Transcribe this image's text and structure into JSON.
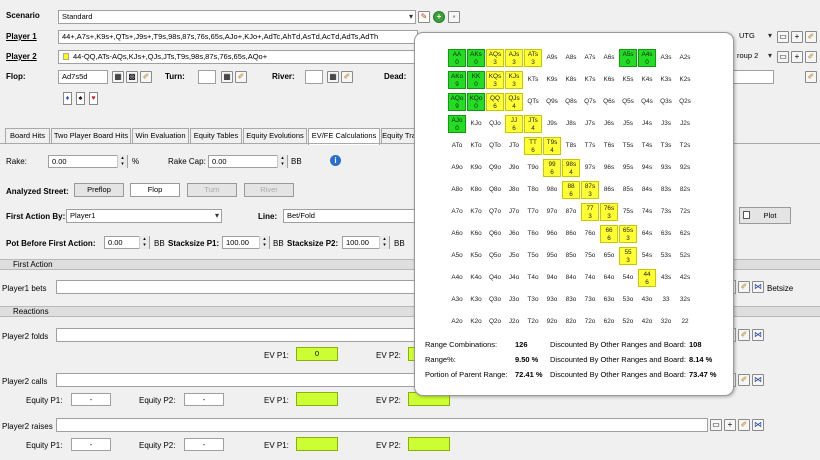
{
  "scenario": {
    "label": "Scenario",
    "value": "Standard"
  },
  "player1": {
    "label": "Player 1",
    "range": "44+,A7s+,K9s+,QTs+,J9s+,T9s,98s,87s,76s,65s,AJo+,KJo+,AdTc,AhTd,AsTd,AcTd,AdTs,AdTh",
    "position": "UTG"
  },
  "player2": {
    "label": "Player 2",
    "range": "44-QQ,ATs-AQs,KJs+,QJs,JTs,T9s,98s,87s,76s,65s,AQo+",
    "position": "roup 2"
  },
  "board": {
    "flop_label": "Flop:",
    "flop": "Ad7s5d",
    "turn_label": "Turn:",
    "river_label": "River:",
    "dead_label": "Dead:",
    "suit_icons": [
      "♦",
      "♠",
      "♥"
    ]
  },
  "tabs": [
    "Board Hits",
    "Two Player Board Hits",
    "Win Evaluation",
    "Equity Tables",
    "Equity Evolutions",
    "EV/FE Calculations",
    "Equity Tra"
  ],
  "rake": {
    "label": "Rake:",
    "value": "0.00",
    "unit": "%",
    "cap_label": "Rake Cap:",
    "cap_value": "0.00",
    "cap_unit": "BB"
  },
  "analyzed_street": {
    "label": "Analyzed Street:",
    "options": [
      "Preflop",
      "Flop",
      "Turn",
      "River"
    ]
  },
  "first_action": {
    "label": "First Action By:",
    "value": "Player1",
    "line_label": "Line:",
    "line_value": "Bet/Fold",
    "plot": "Plot"
  },
  "pot": {
    "label": "Pot Before First Action:",
    "value": "0.00",
    "unit": "BB",
    "stack1_label": "Stacksize P1:",
    "stack1": "100.00",
    "stack1_unit": "BB",
    "stack2_label": "Stacksize P2:",
    "stack2": "100.00",
    "stack2_unit": "BB"
  },
  "sections": {
    "first_action": "First Action",
    "reactions": "Reactions"
  },
  "rows": {
    "p1_bets": "Player1 bets",
    "betsize": "Betsize",
    "p2_folds": "Player2 folds",
    "p2_calls": "Player2 calls",
    "p2_raises": "Player2 raises",
    "ev_p1": "EV P1:",
    "ev_p2": "EV P2:",
    "equity_p1": "Equity P1:",
    "equity_p2": "Equity P2:",
    "fold_ev_p1": "0",
    "dash": "-"
  },
  "matrix": {
    "rows": [
      [
        [
          "AA",
          "0"
        ],
        [
          "AKs",
          "0"
        ],
        [
          "AQs",
          "3"
        ],
        [
          "AJs",
          "3"
        ],
        [
          "ATs",
          "3"
        ],
        [
          "A9s",
          ""
        ],
        [
          "A8s",
          ""
        ],
        [
          "A7s",
          ""
        ],
        [
          "A6s",
          ""
        ],
        [
          "A5s",
          "0"
        ],
        [
          "A4s",
          "0"
        ],
        [
          "A3s",
          ""
        ],
        [
          "A2s",
          ""
        ]
      ],
      [
        [
          "AKo",
          "9"
        ],
        [
          "KK",
          "0"
        ],
        [
          "KQs",
          "3"
        ],
        [
          "KJs",
          "3"
        ],
        [
          "KTs",
          ""
        ],
        [
          "K9s",
          ""
        ],
        [
          "K8s",
          ""
        ],
        [
          "K7s",
          ""
        ],
        [
          "K6s",
          ""
        ],
        [
          "K5s",
          ""
        ],
        [
          "K4s",
          ""
        ],
        [
          "K3s",
          ""
        ],
        [
          "K2s",
          ""
        ]
      ],
      [
        [
          "AQo",
          "9"
        ],
        [
          "KQo",
          "0"
        ],
        [
          "QQ",
          "6"
        ],
        [
          "QJs",
          "4"
        ],
        [
          "QTs",
          ""
        ],
        [
          "Q9s",
          ""
        ],
        [
          "Q8s",
          ""
        ],
        [
          "Q7s",
          ""
        ],
        [
          "Q6s",
          ""
        ],
        [
          "Q5s",
          ""
        ],
        [
          "Q4s",
          ""
        ],
        [
          "Q3s",
          ""
        ],
        [
          "Q2s",
          ""
        ]
      ],
      [
        [
          "AJo",
          "0"
        ],
        [
          "KJo",
          ""
        ],
        [
          "QJo",
          ""
        ],
        [
          "JJ",
          "6"
        ],
        [
          "JTs",
          "4"
        ],
        [
          "J9s",
          ""
        ],
        [
          "J8s",
          ""
        ],
        [
          "J7s",
          ""
        ],
        [
          "J6s",
          ""
        ],
        [
          "J5s",
          ""
        ],
        [
          "J4s",
          ""
        ],
        [
          "J3s",
          ""
        ],
        [
          "J2s",
          ""
        ]
      ],
      [
        [
          "ATo",
          ""
        ],
        [
          "KTo",
          ""
        ],
        [
          "QTo",
          ""
        ],
        [
          "JTo",
          ""
        ],
        [
          "TT",
          "6"
        ],
        [
          "T9s",
          "4"
        ],
        [
          "T8s",
          ""
        ],
        [
          "T7s",
          ""
        ],
        [
          "T6s",
          ""
        ],
        [
          "T5s",
          ""
        ],
        [
          "T4s",
          ""
        ],
        [
          "T3s",
          ""
        ],
        [
          "T2s",
          ""
        ]
      ],
      [
        [
          "A9o",
          ""
        ],
        [
          "K9o",
          ""
        ],
        [
          "Q9o",
          ""
        ],
        [
          "J9o",
          ""
        ],
        [
          "T9o",
          ""
        ],
        [
          "99",
          "6"
        ],
        [
          "98s",
          "4"
        ],
        [
          "97s",
          ""
        ],
        [
          "96s",
          ""
        ],
        [
          "95s",
          ""
        ],
        [
          "94s",
          ""
        ],
        [
          "93s",
          ""
        ],
        [
          "92s",
          ""
        ]
      ],
      [
        [
          "A8o",
          ""
        ],
        [
          "K8o",
          ""
        ],
        [
          "Q8o",
          ""
        ],
        [
          "J8o",
          ""
        ],
        [
          "T8o",
          ""
        ],
        [
          "98o",
          ""
        ],
        [
          "88",
          "6"
        ],
        [
          "87s",
          "3"
        ],
        [
          "86s",
          ""
        ],
        [
          "85s",
          ""
        ],
        [
          "84s",
          ""
        ],
        [
          "83s",
          ""
        ],
        [
          "82s",
          ""
        ]
      ],
      [
        [
          "A7o",
          ""
        ],
        [
          "K7o",
          ""
        ],
        [
          "Q7o",
          ""
        ],
        [
          "J7o",
          ""
        ],
        [
          "T7o",
          ""
        ],
        [
          "97o",
          ""
        ],
        [
          "87o",
          ""
        ],
        [
          "77",
          "3"
        ],
        [
          "76s",
          "3"
        ],
        [
          "75s",
          ""
        ],
        [
          "74s",
          ""
        ],
        [
          "73s",
          ""
        ],
        [
          "72s",
          ""
        ]
      ],
      [
        [
          "A6o",
          ""
        ],
        [
          "K6o",
          ""
        ],
        [
          "Q6o",
          ""
        ],
        [
          "J6o",
          ""
        ],
        [
          "T6o",
          ""
        ],
        [
          "96o",
          ""
        ],
        [
          "86o",
          ""
        ],
        [
          "76o",
          ""
        ],
        [
          "66",
          "6"
        ],
        [
          "65s",
          "3"
        ],
        [
          "64s",
          ""
        ],
        [
          "63s",
          ""
        ],
        [
          "62s",
          ""
        ]
      ],
      [
        [
          "A5o",
          ""
        ],
        [
          "K5o",
          ""
        ],
        [
          "Q5o",
          ""
        ],
        [
          "J5o",
          ""
        ],
        [
          "T5o",
          ""
        ],
        [
          "95o",
          ""
        ],
        [
          "85o",
          ""
        ],
        [
          "75o",
          ""
        ],
        [
          "65o",
          ""
        ],
        [
          "55",
          "3"
        ],
        [
          "54s",
          ""
        ],
        [
          "53s",
          ""
        ],
        [
          "52s",
          ""
        ]
      ],
      [
        [
          "A4o",
          ""
        ],
        [
          "K4o",
          ""
        ],
        [
          "Q4o",
          ""
        ],
        [
          "J4o",
          ""
        ],
        [
          "T4o",
          ""
        ],
        [
          "94o",
          ""
        ],
        [
          "84o",
          ""
        ],
        [
          "74o",
          ""
        ],
        [
          "64o",
          ""
        ],
        [
          "54o",
          ""
        ],
        [
          "44",
          "6"
        ],
        [
          "43s",
          ""
        ],
        [
          "42s",
          ""
        ]
      ],
      [
        [
          "A3o",
          ""
        ],
        [
          "K3o",
          ""
        ],
        [
          "Q3o",
          ""
        ],
        [
          "J3o",
          ""
        ],
        [
          "T3o",
          ""
        ],
        [
          "93o",
          ""
        ],
        [
          "83o",
          ""
        ],
        [
          "73o",
          ""
        ],
        [
          "63o",
          ""
        ],
        [
          "53o",
          ""
        ],
        [
          "43o",
          ""
        ],
        [
          "33",
          ""
        ],
        [
          "32s",
          ""
        ]
      ],
      [
        [
          "A2o",
          ""
        ],
        [
          "K2o",
          ""
        ],
        [
          "Q2o",
          ""
        ],
        [
          "J2o",
          ""
        ],
        [
          "T2o",
          ""
        ],
        [
          "92o",
          ""
        ],
        [
          "82o",
          ""
        ],
        [
          "72o",
          ""
        ],
        [
          "62o",
          ""
        ],
        [
          "52o",
          ""
        ],
        [
          "42o",
          ""
        ],
        [
          "32o",
          ""
        ],
        [
          "22",
          ""
        ]
      ]
    ],
    "green": [
      "AA",
      "AKs",
      "A5s",
      "A4s",
      "AKo",
      "KK",
      "AQo",
      "KQo",
      "AJo"
    ],
    "yellow": [
      "AQs",
      "AJs",
      "ATs",
      "KQs",
      "KJs",
      "QQ",
      "QJs",
      "JJ",
      "JTs",
      "TT",
      "T9s",
      "99",
      "98s",
      "88",
      "87s",
      "77",
      "76s",
      "66",
      "65s",
      "55",
      "44"
    ]
  },
  "stats": {
    "combos_label": "Range Combinations:",
    "combos": "126",
    "disc1_label": "Discounted By Other Ranges and Board:",
    "disc1": "108",
    "pct_label": "Range%:",
    "pct": "9.50 %",
    "disc2_label": "Discounted By Other Ranges and Board:",
    "disc2": "8.14 %",
    "parent_label": "Portion of Parent Range:",
    "parent": "72.41 %",
    "disc3_label": "Discounted By Other Ranges and Board:",
    "disc3": "73.47 %"
  }
}
